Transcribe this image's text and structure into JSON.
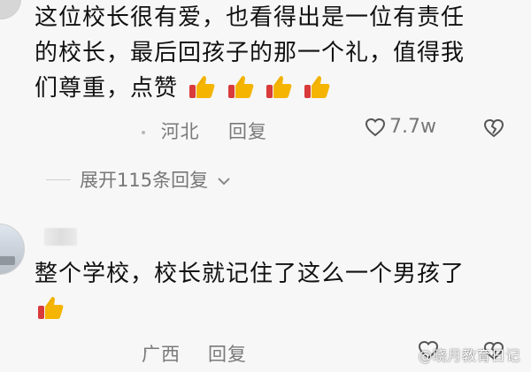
{
  "comments": [
    {
      "lines": [
        "这位校长很有爱，也看得出是一位有责任",
        "的校长，最后回孩子的那一个礼，值得我",
        "们尊重，点赞"
      ],
      "emoji": [
        "thumbs-up-icon",
        "thumbs-up-icon",
        "thumbs-up-icon",
        "thumbs-up-icon"
      ],
      "location": "河北",
      "reply_label": "回复",
      "like_count": "7.7w"
    },
    {
      "text": "整个学校，校长就记住了这么一个男孩了",
      "emoji": [
        "thumbs-up-icon"
      ],
      "location": "广西",
      "reply_label": "回复"
    }
  ],
  "expand_replies_label": "展开115条回复",
  "watermark": "@晓月教育日记",
  "colors": {
    "background": "#f7f7f7",
    "meta_text": "#7a7a7a",
    "thumb_yellow": "#f4b400",
    "thumb_red": "#d93a3a"
  }
}
